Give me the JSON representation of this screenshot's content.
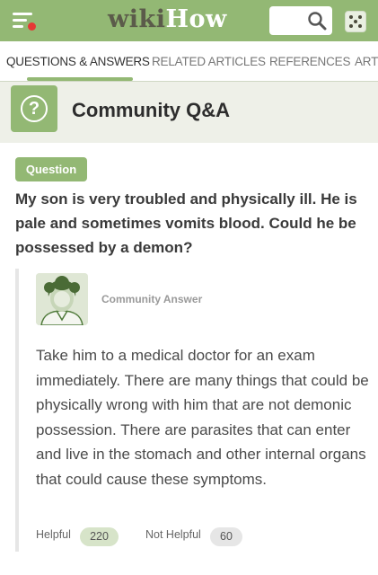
{
  "header": {
    "logo_wiki": "wiki",
    "logo_how": "How",
    "icons": [
      "menu-icon",
      "search-icon",
      "random-dice-icon"
    ]
  },
  "tabs": [
    {
      "label": "QUESTIONS & ANSWERS",
      "active": true
    },
    {
      "label": "RELATED ARTICLES",
      "active": false
    },
    {
      "label": "REFERENCES",
      "active": false
    },
    {
      "label": "ARTI",
      "active": false
    }
  ],
  "section": {
    "title": "Community Q&A",
    "icon": "question-circle-icon"
  },
  "question": {
    "badge": "Question",
    "text": "My son is very troubled and physically ill. He is pale and sometimes vomits blood. Could he be possessed by a demon?"
  },
  "answer": {
    "author_label": "Community Answer",
    "text": "Take him to a medical doctor for an exam immediately. There are many things that could be physically wrong with him that are not demonic possession. There are parasites that can enter and live in the stomach and other internal organs that could cause these symptoms.",
    "helpful_label": "Helpful",
    "helpful_count": "220",
    "not_helpful_label": "Not Helpful",
    "not_helpful_count": "60"
  },
  "colors": {
    "brand_green": "#93b874",
    "alert_dot": "#e53935"
  }
}
